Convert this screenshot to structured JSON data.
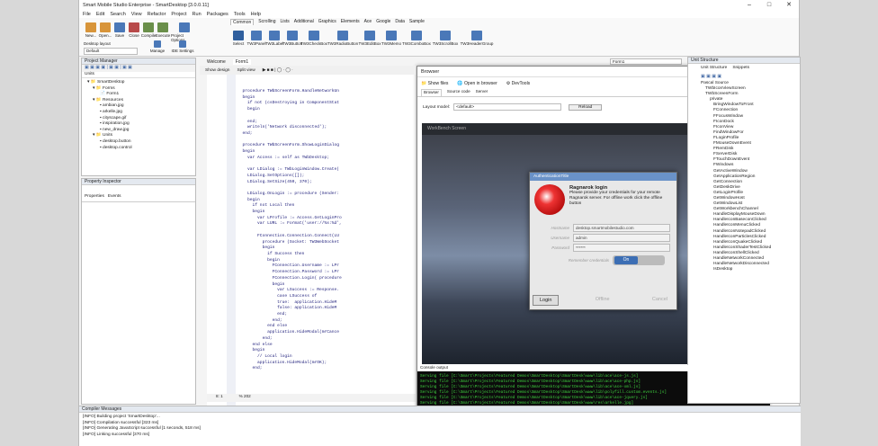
{
  "window": {
    "title": "Smart Mobile Studio Enterprise - SmartDesktop [3.0.0.11]",
    "min": "–",
    "max": "□",
    "close": "✕"
  },
  "menu": [
    "File",
    "Edit",
    "Search",
    "View",
    "Refactor",
    "Project",
    "Run",
    "Packages",
    "Tools",
    "Help"
  ],
  "ribbon": {
    "tabs": [
      "Common",
      "Scrolling",
      "Lists",
      "Additional",
      "Graphics",
      "Elements",
      "Ace",
      "Google",
      "Data",
      "Sample"
    ],
    "left_buttons": [
      "New...",
      "Open...",
      "Save",
      "Close",
      "Compile",
      "Execute",
      "Project Options"
    ],
    "layout_label": "Desktop layout",
    "layout_value": "Default",
    "manage": "Manage",
    "ide_settings": "IDE Settings",
    "components": [
      "Select",
      "TW3Panel",
      "TW3Label",
      "TW3Button",
      "TW3CheckBox",
      "TW3RadioButton",
      "TW3EditBox",
      "TW3Memo",
      "TW3ComboBox",
      "TW3ScrollBox",
      "TW3HeaderGroup"
    ]
  },
  "project_manager": {
    "title": "Project Manager",
    "units_label": "Units",
    "tree": [
      "SmartDesktop",
      "Forms",
      "Form1",
      "Resources",
      "ambian.jpg",
      "arkelle.jpg",
      "cityscape.gif",
      "inspiration.jpg",
      "new_draw.jpg",
      "Units",
      "desktop.button",
      "desktop.control"
    ]
  },
  "property_inspector": {
    "title": "Property Inspector",
    "tabs": [
      "Properties",
      "Events"
    ]
  },
  "editor": {
    "tabs": [
      "Welcome",
      "Form1"
    ],
    "toolbar": [
      "Show design",
      "Split view"
    ],
    "line_numbers": [
      "",
      "320",
      "",
      "",
      "",
      "",
      "",
      "",
      "",
      "330",
      "",
      "",
      "",
      "",
      "",
      "",
      "",
      "",
      "",
      "",
      "",
      "",
      "",
      "",
      "",
      "340",
      "",
      "",
      "",
      "",
      "",
      "",
      "",
      "",
      "",
      "",
      "",
      "",
      "",
      "",
      "350",
      "",
      "",
      "",
      "",
      "",
      "",
      "",
      "",
      "",
      "",
      "",
      "",
      "",
      "",
      "360",
      "",
      "",
      "",
      "",
      "",
      "",
      "",
      "",
      "",
      ""
    ],
    "code": "  procedure TWbScreenForm.HandleNetworkUn\n  begin\n    if not (csDestroying in ComponentStat\n    begin\n\n    end;\n    writeln('Network disconnected');\n  end;\n\n  procedure TWbScreenForm.ShowLoginDialog\n  begin\n    var Access := self as TWbDesktop;\n\n    var LDialog := TWbLoginWindow.Create(\n    LDialog.SetOptions([]);\n    LDialog.SetSize(450, 370);\n\n    LDialog.OnLogin := procedure (Sender:\n    begin\n      if not Local then\n      begin\n        var LProfile := Access.GetLoginPro\n        var LURL := Format('user://%s:%d',\n\n        FConnection.Connection.Connect(LU\n          procedure (Socket: TW3WebSocket\n          begin\n            if Success then\n            begin\n              FConnection.Username := LPr\n              FConnection.Password := LPr\n              FConnection.Login( procedure\n              begin\n                var LSuccess := Response.\n                case LSuccess of\n                true:  application.HideM\n                false: application.HideM\n                end;\n              end;\n            end else\n            application.HideModal(mrCance\n          end;\n      end else\n      begin\n        // Local login\n        application.HideModal(mrOK);\n      end;",
    "status": [
      "8: 1",
      "% 202"
    ]
  },
  "browser": {
    "title": "Browser",
    "toolbar": [
      "Show files",
      "Open in browser",
      "DevTools"
    ],
    "tabs": [
      "Browser",
      "Source code",
      "Server"
    ],
    "layout_label": "Layout model:",
    "layout_value": "<default>",
    "reload": "Reload",
    "screen_title": "WorkBench Screen",
    "console_title": "Console output",
    "console_lines": [
      "Serving file [C:\\Smart\\Projects\\Featured Demos\\SmartDesktop\\SmartDesk\\www\\lib\\ace\\ace-js.js]",
      "Serving file [C:\\Smart\\Projects\\Featured Demos\\SmartDesktop\\SmartDesk\\www\\lib\\ace\\ace-php.js]",
      "Serving file [C:\\Smart\\Projects\\Featured Demos\\SmartDesktop\\SmartDesk\\www\\lib\\ace\\ace-xml.js]",
      "Serving file [C:\\Smart\\Projects\\Featured Demos\\SmartDesktop\\SmartDesk\\www\\lib\\polyfill.custom.events.js]",
      "Serving file [C:\\Smart\\Projects\\Featured Demos\\SmartDesktop\\SmartDesk\\www\\lib\\ace\\ace-jquery.js]",
      "Serving file [C:\\Smart\\Projects\\Featured Demos\\SmartDesktop\\SmartDesk\\www\\res\\arkelle.jpg]"
    ]
  },
  "login": {
    "title": "AuthenticationTitle",
    "heading": "Ragnarok login",
    "text": "Please provide your credentials for your remote Ragnarok server. For offline work click the offline button",
    "host_label": "Hostname",
    "host_value": "desktop.smartmobilestudio.com",
    "user_label": "Username",
    "user_value": "admin",
    "pass_label": "Password",
    "pass_value": "******",
    "remember_label": "Remember credentials",
    "toggle": "On",
    "login": "Login",
    "offline": "Offline",
    "cancel": "Cancel"
  },
  "unit_structure": {
    "title": "Unit Structure",
    "tabs": [
      "Unit Structure",
      "Snippets"
    ],
    "items": [
      "Pascal Source",
      "TWbIconViewScreen",
      "TWbScreenForm",
      "private",
      "BringWindowToFront",
      "FConnection",
      "FFocusWindow",
      "FIconDock",
      "FIconView",
      "FindWindowFor",
      "FLoginProfile",
      "FMouseDownEvent",
      "FRemDisk",
      "FServerDisk",
      "FTouchDownEvent",
      "FWindows",
      "GetActiveWindow",
      "GetApplicationRegion",
      "GetConnection",
      "GetDeskDrive",
      "GetLoginProfile",
      "GetWindowHost",
      "GetWindowList",
      "GetWorkbenchChannel",
      "HandleDisplayMouseDown",
      "HandleIconBaseconClicked",
      "HandleIconMenuClicked",
      "HandleIconNotepadClicked",
      "HandleIconParticlesClicked",
      "HandleIconQuakeClicked",
      "HandleIconShaderTestClicked",
      "HandleIconShellClicked",
      "HandleNetworkConnected",
      "HandleNetworkDisconnected",
      "IsDesktop"
    ],
    "footer": "TxtSymbol"
  },
  "compiler": {
    "title": "Compiler Messages",
    "lines": [
      "[INFO] Building project 'SmartDesktop'...",
      "[INFO] Compilation successful [323 ms]",
      "[INFO] Generating JavaScript successful [1 seconds, 518 ms]",
      "[INFO] Linking successful [370 ms]"
    ]
  },
  "side_combo": "Form1"
}
